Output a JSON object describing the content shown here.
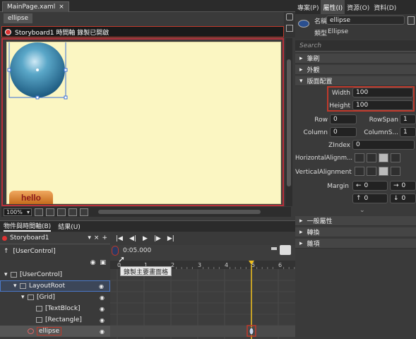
{
  "doc_tab": {
    "label": "MainPage.xaml"
  },
  "sub_tab": {
    "label": "ellipse"
  },
  "recording": {
    "text": "Storyboard1 時間軸 錄製已開啟"
  },
  "artboard": {
    "button_text": "hello"
  },
  "zoom": {
    "value": "100%"
  },
  "panel_tabs": {
    "objects": "物件與時間軸(B)",
    "results": "結果(U)"
  },
  "storyboard": {
    "name": "Storyboard1"
  },
  "timeline": {
    "time": "0:05.000",
    "tooltip": "錄製主要畫面格",
    "ticks": [
      "0",
      "1",
      "2",
      "3",
      "4",
      "5",
      "6"
    ],
    "playhead_seconds": 5,
    "keyframe_seconds": 5
  },
  "tree": {
    "root_header": "[UserControl]",
    "items": [
      {
        "label": "[UserControl]",
        "indent": 0
      },
      {
        "label": "LayoutRoot",
        "indent": 1
      },
      {
        "label": "[Grid]",
        "indent": 2
      },
      {
        "label": "[TextBlock]",
        "indent": 3
      },
      {
        "label": "[Rectangle]",
        "indent": 3
      },
      {
        "label": "ellipse",
        "indent": 2
      }
    ]
  },
  "right_tabs": [
    "專案(P)",
    "屬性(I)",
    "資源(O)",
    "資料(D)"
  ],
  "header": {
    "name_label": "名稱",
    "name_value": "ellipse",
    "type_label": "類型",
    "type_value": "Ellipse"
  },
  "search": {
    "placeholder": "Search"
  },
  "categories": {
    "brush": "筆刷",
    "appearance": "外觀",
    "layout": "版面配置",
    "common": "一般屬性",
    "transform": "轉換",
    "misc": "雜項"
  },
  "layout": {
    "width_label": "Width",
    "width_value": "100",
    "height_label": "Height",
    "height_value": "100",
    "row_label": "Row",
    "row_value": "0",
    "rowspan_label": "RowSpan",
    "rowspan_value": "1",
    "column_label": "Column",
    "column_value": "0",
    "columnspan_label": "ColumnS...",
    "columnspan_value": "1",
    "zindex_label": "ZIndex",
    "zindex_value": "0",
    "halign_label": "HorizontalAlignm...",
    "valign_label": "VerticalAlignment",
    "margin_label": "Margin",
    "margin_values": [
      "0",
      "0",
      "0",
      "0"
    ]
  },
  "colors": {
    "record_red": "#c0392b",
    "artboard": "#fbf6c2",
    "ellipse": "#2e7fa7",
    "playhead": "#f0c020"
  }
}
